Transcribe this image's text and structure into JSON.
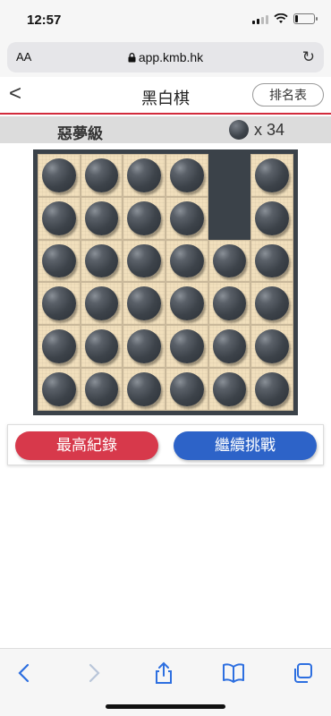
{
  "status": {
    "time": "12:57"
  },
  "browser": {
    "aa_label": "AA",
    "url": "app.kmb.hk"
  },
  "header": {
    "back": "<",
    "title": "黑白棋",
    "rank_button": "排名表"
  },
  "level": {
    "name": "惡夢級",
    "count_text": "x 34"
  },
  "board": {
    "size": 6,
    "cells": [
      [
        "black",
        "black",
        "black",
        "black",
        "empty",
        "black"
      ],
      [
        "black",
        "black",
        "black",
        "black",
        "empty",
        "black"
      ],
      [
        "black",
        "black",
        "black",
        "black",
        "black",
        "black"
      ],
      [
        "black",
        "black",
        "black",
        "black",
        "black",
        "black"
      ],
      [
        "black",
        "black",
        "black",
        "black",
        "black",
        "black"
      ],
      [
        "black",
        "black",
        "black",
        "black",
        "black",
        "black"
      ]
    ]
  },
  "actions": {
    "record_label": "最高紀錄",
    "challenge_label": "繼續挑戰"
  },
  "colors": {
    "accent_red": "#d7394b",
    "accent_blue": "#2d63c8",
    "header_line": "#d22b3c",
    "board_frame": "#3b4249"
  },
  "toolbar": {
    "back_icon": "chevron-left-icon",
    "forward_icon": "chevron-right-icon",
    "share_icon": "share-icon",
    "bookmarks_icon": "book-icon",
    "tabs_icon": "tabs-icon"
  }
}
